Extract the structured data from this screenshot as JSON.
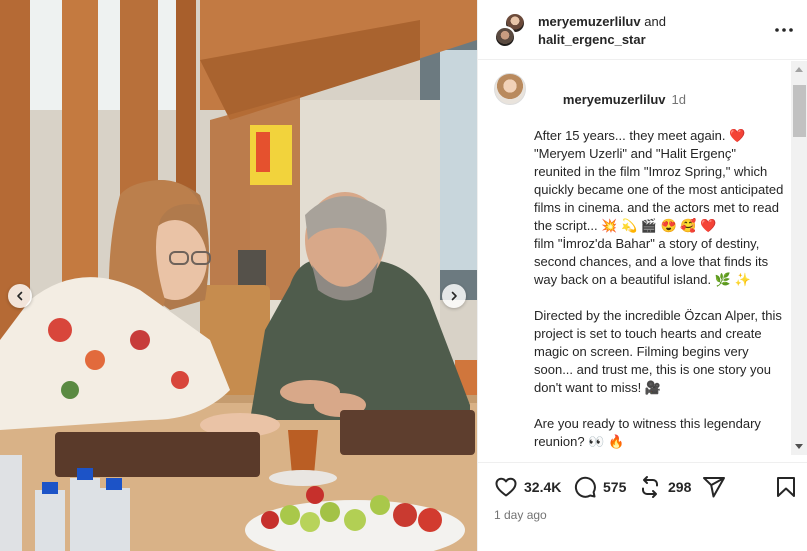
{
  "header": {
    "user1": "meryemuzerliluv",
    "and_text": "and",
    "user2": "halit_ergenc_star"
  },
  "caption": {
    "username": "meryemuzerliluv",
    "time": "1d",
    "line1": "After 15 years... they meet again. ❤️ \"Meryem Uzerli\" and \"Halit Ergenç\" reunited in the film \"Imroz Spring,\" which quickly became one of the most anticipated films in cinema. and the actors met to read the script... 💥 💫 🎬 😍 🥰 ❤️",
    "line2": "film \"İmroz'da Bahar\" a story of destiny, second chances, and a love that finds its way back on a beautiful island. 🌿 ✨",
    "line3": "Directed by the incredible Özcan Alper, this project is set to touch hearts and create magic on screen. Filming begins very soon... and trust me, this is one story you don't want to miss! 🎥",
    "line4": "Are you ready to witness this legendary reunion? 👀 🔥"
  },
  "actions": {
    "likes": "32.4K",
    "comments": "575",
    "reposts": "298"
  },
  "timestamp": "1 day ago",
  "colors": {
    "text": "#262626",
    "muted": "#737373",
    "divider": "#efefef"
  },
  "icons": [
    "chevron-left-icon",
    "chevron-right-icon",
    "more-icon",
    "heart-icon",
    "comment-icon",
    "repost-icon",
    "share-icon",
    "bookmark-icon"
  ]
}
